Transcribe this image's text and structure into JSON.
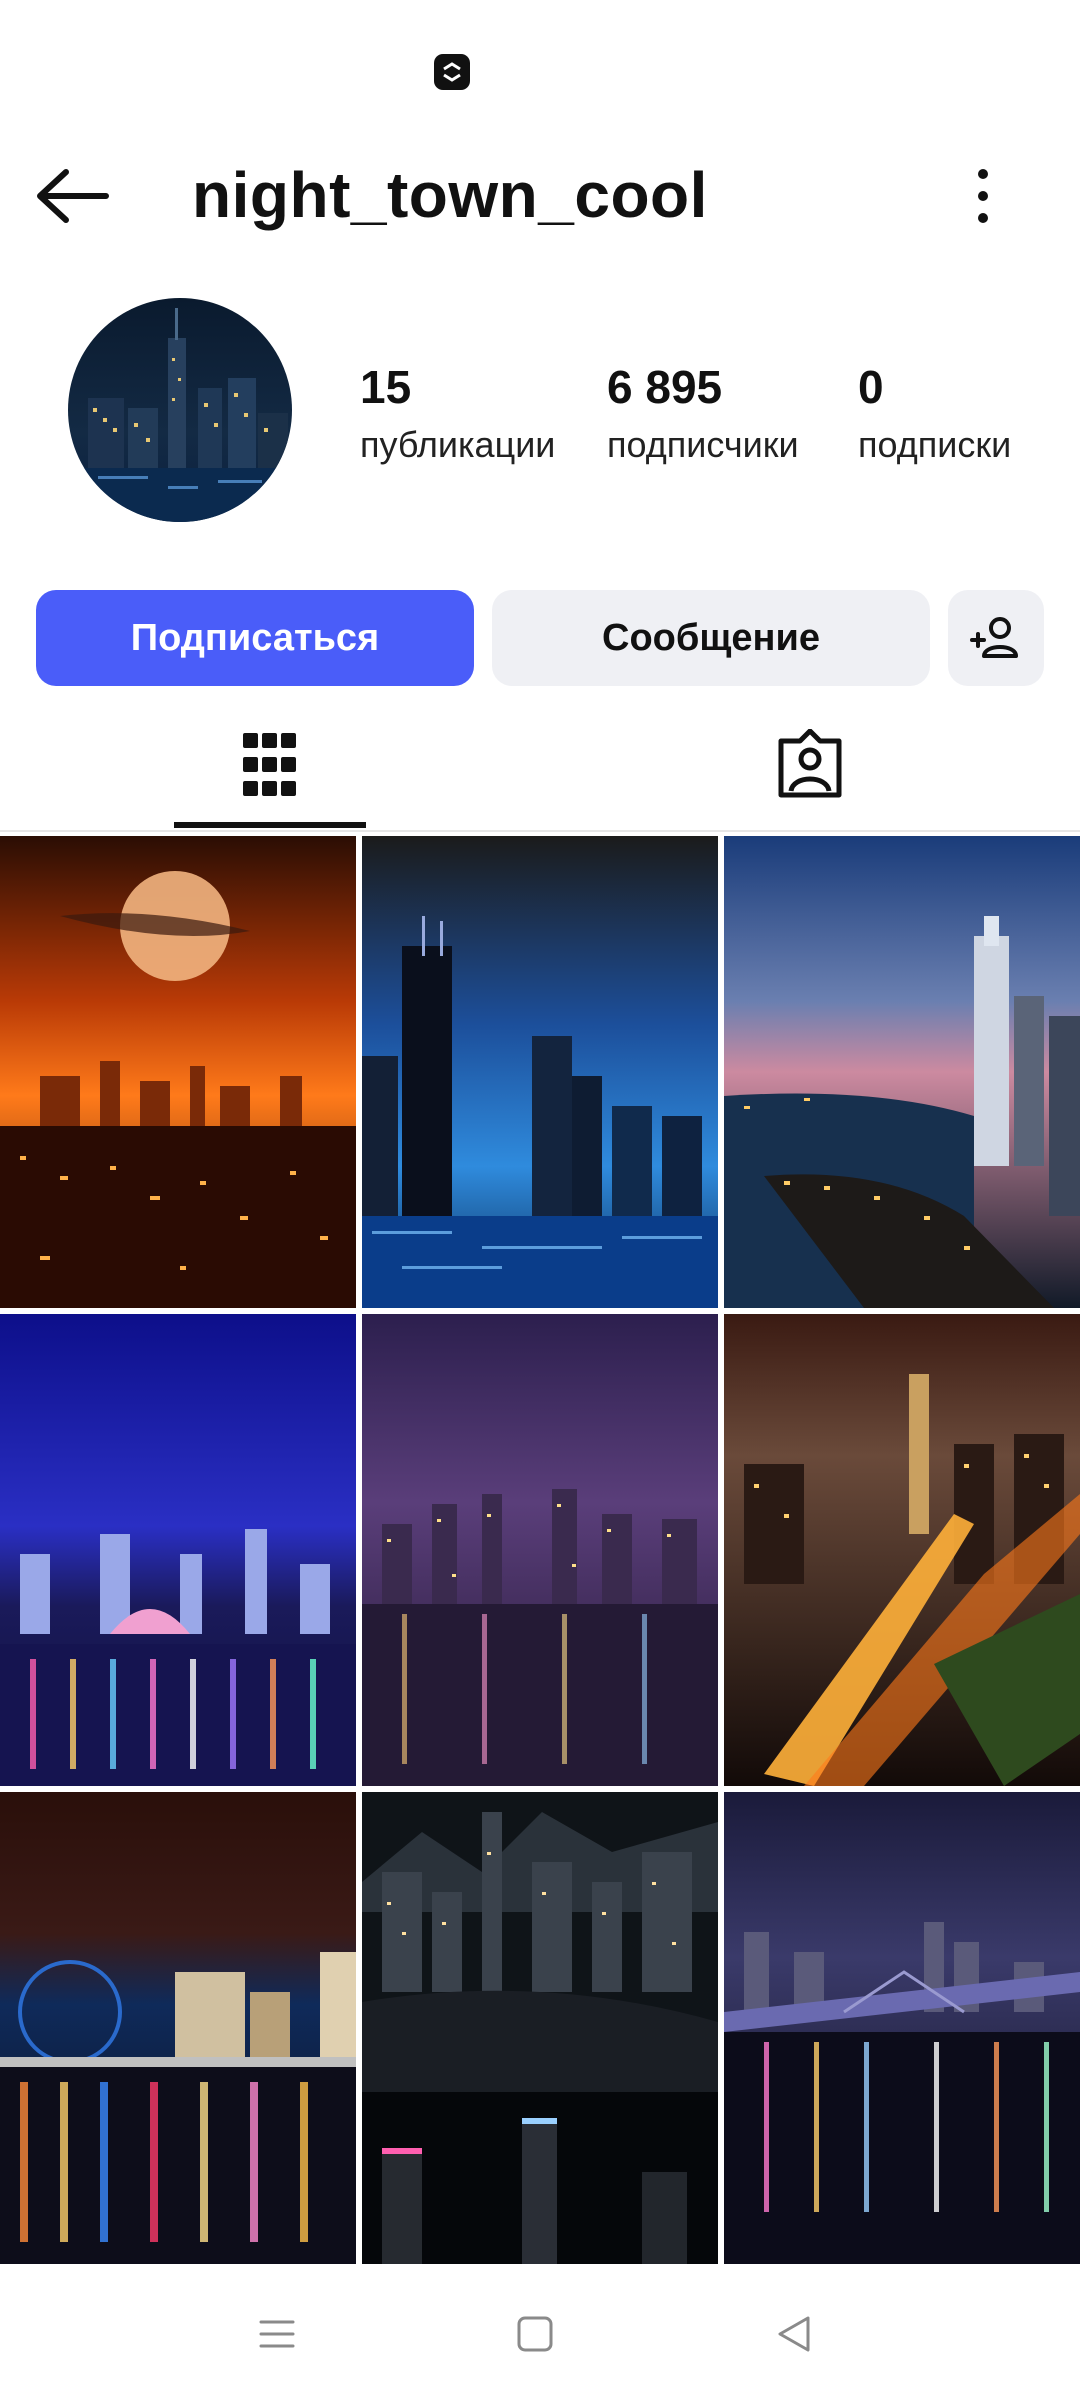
{
  "header": {
    "username": "night_town_cool"
  },
  "stats": [
    {
      "value": "15",
      "label": "публикации"
    },
    {
      "value": "6 895",
      "label": "подписчики"
    },
    {
      "value": "0",
      "label": "подписки"
    }
  ],
  "actions": {
    "follow_label": "Подписаться",
    "message_label": "Сообщение"
  },
  "colors": {
    "accent": "#4a5df9",
    "secondary_button": "#eff0f4",
    "text": "#111111"
  },
  "tabs": [
    {
      "icon": "grid-icon",
      "active": true
    },
    {
      "icon": "tagged-person-icon",
      "active": false
    }
  ],
  "posts": [
    "post-1",
    "post-2",
    "post-3",
    "post-4",
    "post-5",
    "post-6",
    "post-7",
    "post-8",
    "post-9"
  ],
  "navigation": [
    "menu-icon",
    "home-square-icon",
    "back-triangle-icon"
  ]
}
